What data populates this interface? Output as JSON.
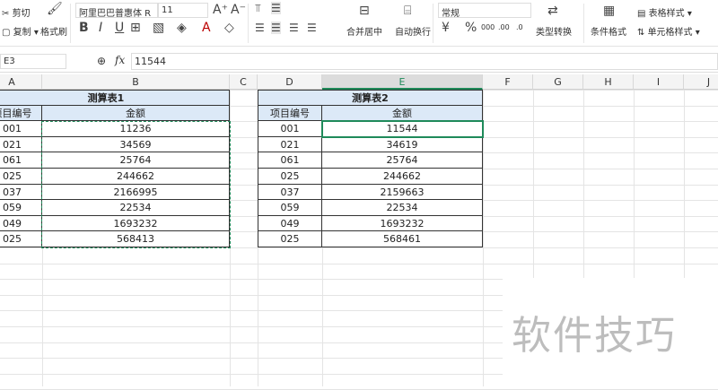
{
  "ribbon": {
    "cut": "剪切",
    "copy": "复制",
    "format_painter": "格式刷",
    "font_name": "阿里巴巴普惠体 R",
    "font_size": "11",
    "merge_center": "合并居中",
    "wrap_text": "自动换行",
    "number_format": "常规",
    "type_convert": "类型转换",
    "conditional_format": "条件格式",
    "table_style": "表格样式",
    "cell_style": "单元格样式",
    "currency_symbol": "¥",
    "percent_symbol": "%"
  },
  "formula_bar": {
    "cell_ref": "E3",
    "fx": "fx",
    "value": "11544"
  },
  "columns": [
    "A",
    "B",
    "C",
    "D",
    "E",
    "F",
    "G",
    "H",
    "I",
    "J"
  ],
  "active_column": "E",
  "table1": {
    "title": "测算表1",
    "headers": [
      "项目编号",
      "金额"
    ],
    "rows": [
      [
        "001",
        "11236"
      ],
      [
        "021",
        "34569"
      ],
      [
        "061",
        "25764"
      ],
      [
        "025",
        "244662"
      ],
      [
        "037",
        "2166995"
      ],
      [
        "059",
        "22534"
      ],
      [
        "049",
        "1693232"
      ],
      [
        "025",
        "568413"
      ]
    ]
  },
  "table2": {
    "title": "测算表2",
    "headers": [
      "项目编号",
      "金额"
    ],
    "rows": [
      [
        "001",
        "11544"
      ],
      [
        "021",
        "34619"
      ],
      [
        "061",
        "25764"
      ],
      [
        "025",
        "244662"
      ],
      [
        "037",
        "2159663"
      ],
      [
        "059",
        "22534"
      ],
      [
        "049",
        "1693232"
      ],
      [
        "025",
        "568461"
      ]
    ]
  },
  "watermark": "软件技巧",
  "colors": {
    "accent": "#1f8a5a",
    "header_fill": "#dce9f7"
  }
}
